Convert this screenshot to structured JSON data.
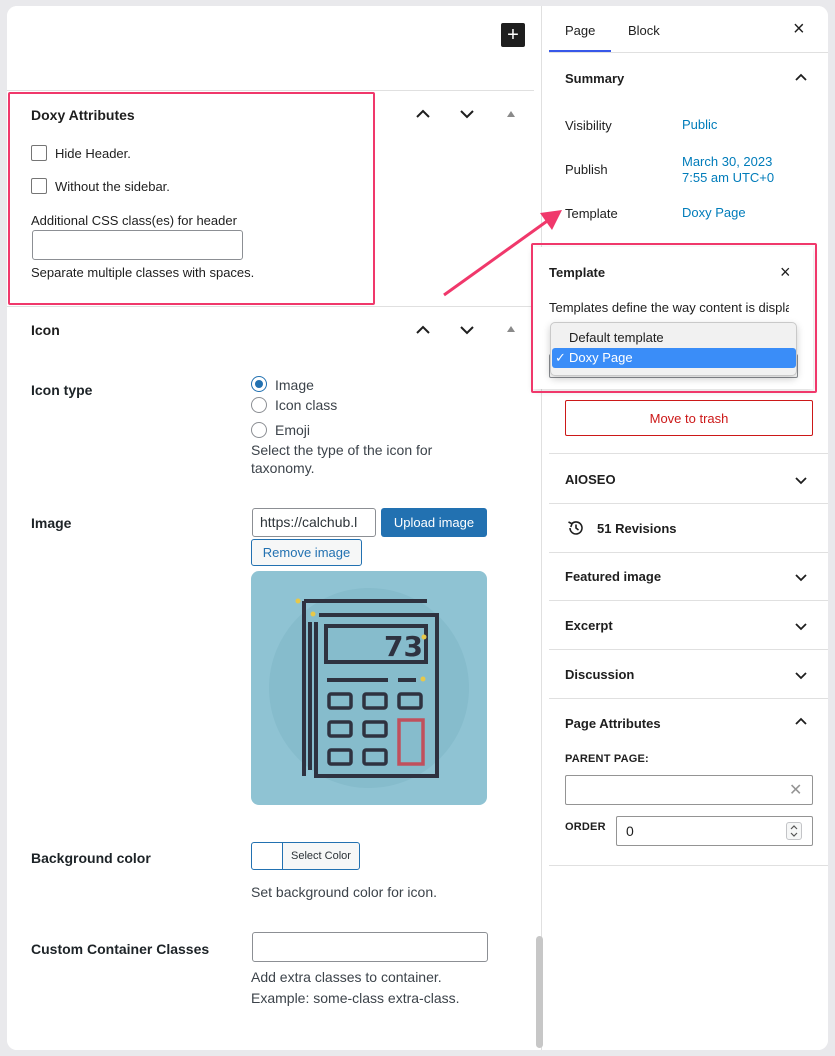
{
  "editor": {
    "add_block_label": "+"
  },
  "doxy_panel": {
    "title": "Doxy Attributes",
    "hide_header_label": "Hide Header.",
    "without_sidebar_label": "Without the sidebar.",
    "css_classes_label": "Additional CSS class(es) for header",
    "css_classes_value": "",
    "css_classes_help": "Separate multiple classes with spaces."
  },
  "icon_panel": {
    "title": "Icon",
    "icon_type": {
      "label": "Icon type",
      "options": [
        "Image",
        "Icon class",
        "Emoji"
      ],
      "selected": "Image",
      "help_line1": "Select the type of the icon for",
      "help_line2": "taxonomy."
    },
    "image": {
      "label": "Image",
      "url_value": "https://calchub.l",
      "upload_label": "Upload image",
      "remove_label": "Remove image",
      "preview_number": "73"
    },
    "background_color": {
      "label": "Background color",
      "select_label": "Select Color",
      "help": "Set background color for icon."
    },
    "custom_classes": {
      "label": "Custom Container Classes",
      "value": "",
      "help_line1": "Add extra classes to container.",
      "help_line2": "Example: some-class extra-class."
    }
  },
  "sidebar": {
    "tabs": [
      {
        "label": "Page",
        "active": true
      },
      {
        "label": "Block",
        "active": false
      }
    ],
    "close_label": "×",
    "summary": {
      "title": "Summary",
      "visibility_key": "Visibility",
      "visibility_value": "Public",
      "publish_key": "Publish",
      "publish_value_line1": "March 30, 2023",
      "publish_value_line2": "7:55 am UTC+0",
      "template_key": "Template",
      "template_value": "Doxy Page"
    },
    "template_popover": {
      "title": "Template",
      "description": "Templates define the way content is displayed when viewing your site.",
      "options": [
        "Default template",
        "Doxy Page"
      ],
      "selected": "Doxy Page"
    },
    "move_to_trash": "Move to trash",
    "sections": {
      "aioseo": "AIOSEO",
      "revisions": "51 Revisions",
      "featured_image": "Featured image",
      "excerpt": "Excerpt",
      "discussion": "Discussion",
      "page_attributes": "Page Attributes"
    },
    "page_attributes": {
      "parent_label": "PARENT PAGE:",
      "parent_value": "",
      "order_label": "ORDER",
      "order_value": "0"
    }
  },
  "colors": {
    "accent_blue": "#2271b1",
    "link_blue": "#007cba",
    "annotation_pink": "#f0386b",
    "danger_red": "#cc1818",
    "menu_highlight": "#3a8df8",
    "icon_bg": "#8fc3d3"
  }
}
